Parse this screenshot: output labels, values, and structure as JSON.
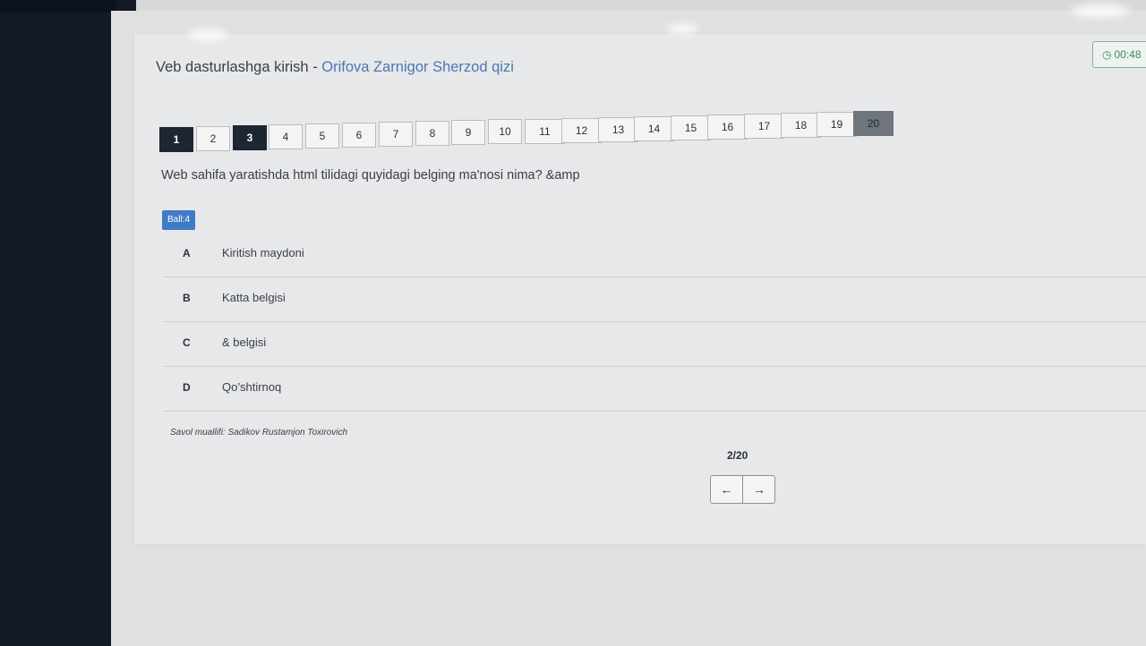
{
  "header": {
    "course": "Veb dasturlashga kirish",
    "separator": " - ",
    "student": "Orifova Zarnigor Sherzod qizi",
    "timer": "00:48",
    "timer_icon": "clock-icon"
  },
  "nav": {
    "questions": [
      "1",
      "2",
      "3",
      "4",
      "5",
      "6",
      "7",
      "8",
      "9",
      "10",
      "11",
      "12",
      "13",
      "14",
      "15",
      "16",
      "17",
      "18",
      "19",
      "20"
    ],
    "answered": [
      "1",
      "3"
    ],
    "hovered": "20"
  },
  "question": {
    "text": "Web sahifa yaratishda html tilidagi quyidagi belging ma'nosi nima? &amp",
    "ball": "Ball:4"
  },
  "options": [
    {
      "letter": "A",
      "text": "Kiritish maydoni"
    },
    {
      "letter": "B",
      "text": "Katta belgisi"
    },
    {
      "letter": "C",
      "text": "& belgisi"
    },
    {
      "letter": "D",
      "text": "Qo’shtirnoq"
    }
  ],
  "footer": {
    "author": "Savol muallifi: Sadikov Rustamjon Toxirovich",
    "counter": "2/20",
    "prev_icon": "arrow-left-icon",
    "next_icon": "arrow-right-icon"
  },
  "colors": {
    "accent": "#3f7cc4",
    "student_name": "#4a77b2",
    "answered_bg": "#1d2633",
    "timer_green": "#3f8a58"
  }
}
